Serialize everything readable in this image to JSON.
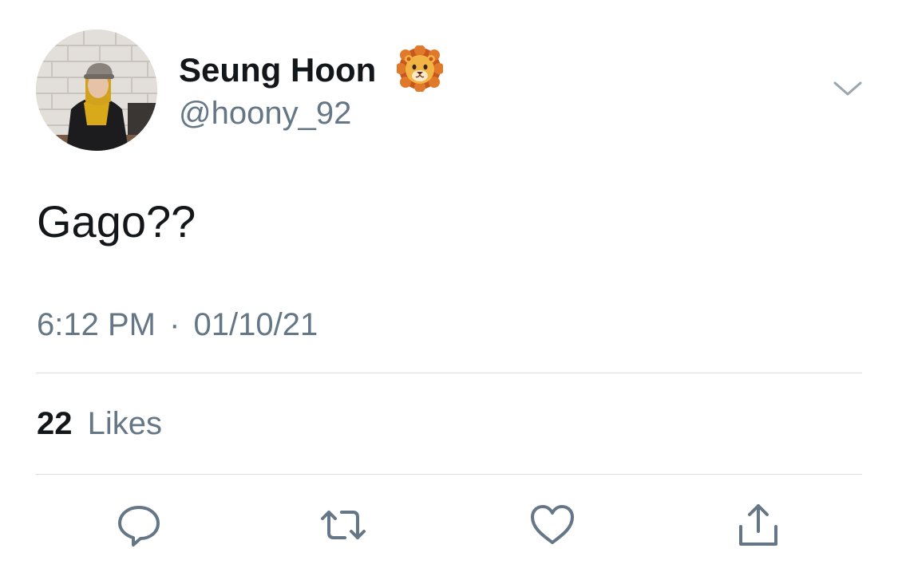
{
  "author": {
    "display_name": "Seung Hoon",
    "handle": "@hoony_92",
    "name_emoji_icon": "lion-face-icon",
    "avatar": "profile-photo"
  },
  "tweet": {
    "text": "Gago??",
    "time": "6:12 PM",
    "separator": "·",
    "date": "01/10/21"
  },
  "stats": {
    "likes_count": "22",
    "likes_label": "Likes"
  },
  "actions": [
    {
      "name": "reply",
      "icon": "reply-bubble-icon"
    },
    {
      "name": "retweet",
      "icon": "retweet-icon"
    },
    {
      "name": "like",
      "icon": "heart-icon"
    },
    {
      "name": "share",
      "icon": "share-icon"
    }
  ],
  "colors": {
    "primary_text": "#14171a",
    "secondary_text": "#657786",
    "divider": "#d8dfe4",
    "icon": "#657786"
  }
}
